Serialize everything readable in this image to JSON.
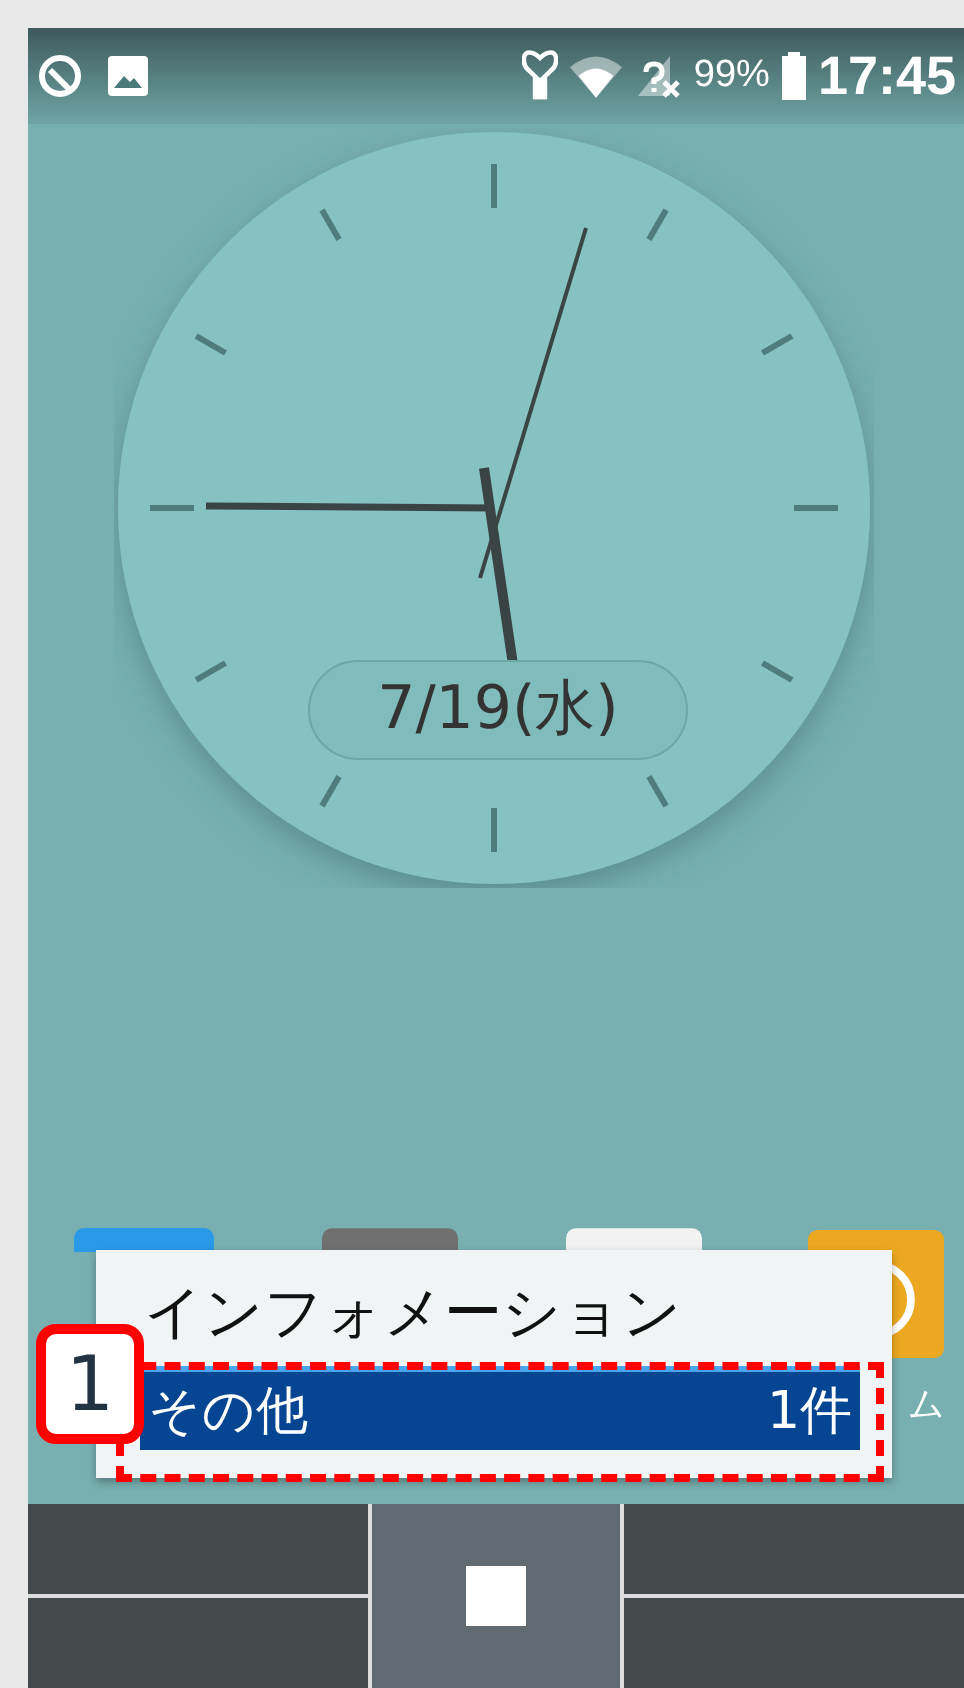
{
  "status_bar": {
    "battery": "99%",
    "time": "17:45"
  },
  "clock": {
    "date": "7/19(水)"
  },
  "apps": [
    {
      "kind": "weather"
    },
    {
      "kind": "news"
    },
    {
      "kind": "transit"
    },
    {
      "kind": "alarm",
      "label": "ム"
    }
  ],
  "popup": {
    "title": "インフォメーション",
    "items": [
      {
        "label": "その他",
        "count": "1件",
        "selected": true
      }
    ]
  },
  "callout": {
    "number": "1"
  }
}
